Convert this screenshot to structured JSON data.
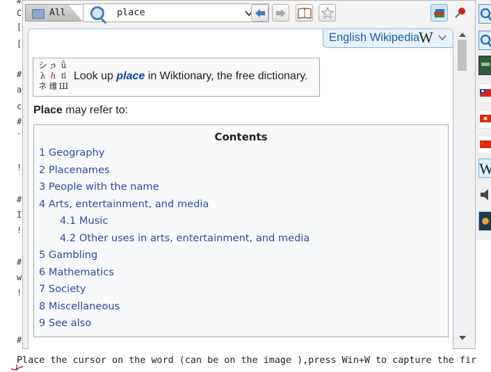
{
  "background_editor": {
    "bottom_line": "Place the cursor on the word (can be on the  image ),press Win+W to capture the fir",
    "left_chars": [
      "#",
      "C",
      "[",
      "[",
      "#",
      "a",
      "c",
      "#",
      "`",
      "!",
      "#",
      "I",
      "!",
      "#",
      "w",
      "!",
      "#"
    ]
  },
  "toolbar": {
    "scope_label": "All",
    "search_value": "place",
    "icons": [
      "folder-icon",
      "search-icon",
      "dropdown-icon",
      "back-arrow-icon",
      "forward-arrow-icon",
      "book-icon",
      "star-icon",
      "dictionaries-icon",
      "pin-icon"
    ]
  },
  "source": {
    "label": "English Wikipedia",
    "logo": "W"
  },
  "wiktionary": {
    "glyphs": [
      "シ",
      "ኃ",
      "ǚ",
      "λ",
      "ℎ",
      "ជ",
      "ネ",
      "维",
      "Ш"
    ],
    "prefix": "Look up ",
    "word": "place",
    "suffix": " in Wiktionary, the free dictionary."
  },
  "refer": {
    "word": "Place",
    "text": " may refer to:"
  },
  "toc": {
    "title": "Contents",
    "items": [
      {
        "num": "1",
        "label": "Geography",
        "level": 1
      },
      {
        "num": "2",
        "label": "Placenames",
        "level": 1
      },
      {
        "num": "3",
        "label": "People with the name",
        "level": 1
      },
      {
        "num": "4",
        "label": "Arts, entertainment, and media",
        "level": 1
      },
      {
        "num": "4.1",
        "label": "Music",
        "level": 2
      },
      {
        "num": "4.2",
        "label": "Other uses in arts, entertainment, and media",
        "level": 2
      },
      {
        "num": "5",
        "label": "Gambling",
        "level": 1
      },
      {
        "num": "6",
        "label": "Mathematics",
        "level": 1
      },
      {
        "num": "7",
        "label": "Society",
        "level": 1
      },
      {
        "num": "8",
        "label": "Miscellaneous",
        "level": 1
      },
      {
        "num": "9",
        "label": "See also",
        "level": 1
      }
    ]
  },
  "dictionary_bar": {
    "icons": [
      "search-dict-icon",
      "search-dict-icon",
      "book-dict-icon",
      "taiwan-flag-icon",
      "hongkong-flag-icon",
      "china-flag-icon",
      "wikipedia-icon",
      "speaker-icon",
      "book-cover-icon"
    ]
  },
  "colors": {
    "link": "#2c4aa3",
    "accent": "#1b5faa",
    "panel_border": "#9ec1e6"
  }
}
